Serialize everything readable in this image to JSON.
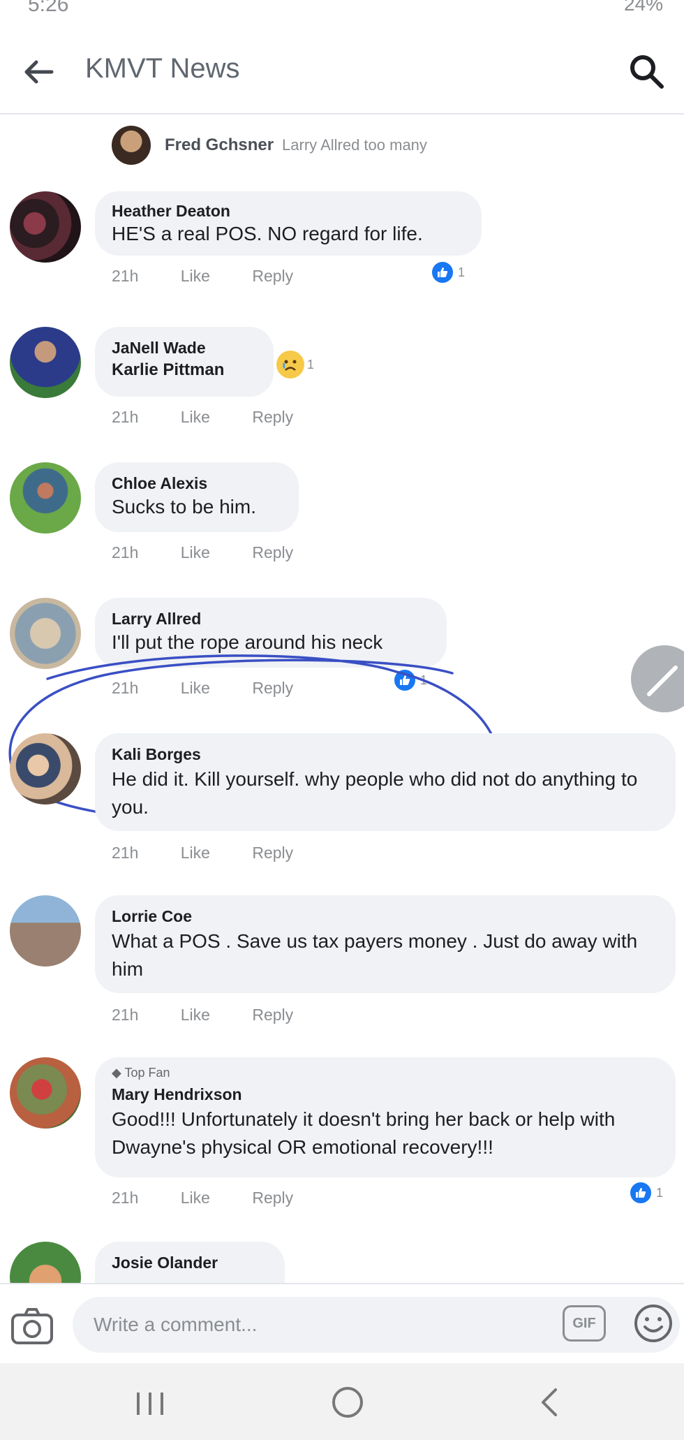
{
  "status_bar": {
    "time": "5:26",
    "battery": "24%"
  },
  "header": {
    "title": "KMVT News",
    "back_icon": "back-arrow-icon",
    "search_icon": "search-icon"
  },
  "previous_reply": {
    "author": "Fred Gchsner",
    "text": "Larry Allred too many"
  },
  "comments": [
    {
      "author": "Heather Deaton",
      "text": "HE'S a real POS.  NO regard for life.",
      "time": "21h",
      "like": "Like",
      "reply": "Reply",
      "reaction_count": "1"
    },
    {
      "author": "JaNell Wade",
      "text": "Karlie Pittman",
      "time": "21h",
      "like": "Like",
      "reply": "Reply",
      "reaction_count": "1"
    },
    {
      "author": "Chloe Alexis",
      "text": "Sucks to be him.",
      "time": "21h",
      "like": "Like",
      "reply": "Reply"
    },
    {
      "author": "Larry Allred",
      "text": "I'll put the rope around his neck",
      "time": "21h",
      "like": "Like",
      "reply": "Reply",
      "reaction_count": "1"
    },
    {
      "author": "Kali Borges",
      "text": "He did it. Kill yourself.  why people who did not do anything to you.",
      "time": "21h",
      "like": "Like",
      "reply": "Reply"
    },
    {
      "author": "Lorrie Coe",
      "text": "What a POS . Save us tax payers money . Just do away with  him",
      "time": "21h",
      "like": "Like",
      "reply": "Reply"
    },
    {
      "badge": "Top Fan",
      "author": "Mary Hendrixson",
      "text": "Good!!! Unfortunately it doesn't bring her back or help with Dwayne's physical OR emotional recovery!!!",
      "time": "21h",
      "like": "Like",
      "reply": "Reply",
      "reaction_count": "1"
    },
    {
      "author": "Josie Olander"
    }
  ],
  "composer": {
    "placeholder": "Write a comment...",
    "gif_label": "GIF"
  },
  "colors": {
    "accent": "#1877f2",
    "bubble": "#f0f2f5",
    "annotation_ink": "#3a4fc4"
  }
}
